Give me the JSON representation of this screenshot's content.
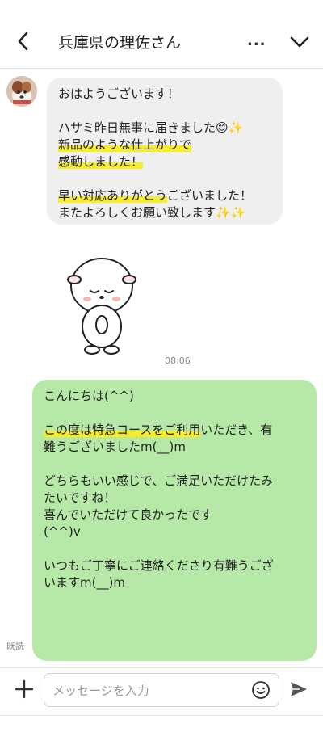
{
  "header": {
    "title": "兵庫県の理佐さん",
    "more_label": "...",
    "icons": {
      "back": "back-arrow-icon",
      "expand": "chevron-down-icon"
    }
  },
  "incoming": {
    "lines": [
      {
        "text": "おはようございます！",
        "highlight": ""
      },
      {
        "text": "",
        "highlight": ""
      },
      {
        "text": "ハサミ昨日無事に届きました😊✨",
        "highlight": ""
      },
      {
        "text": "新品のような仕上がりで",
        "highlight": "all"
      },
      {
        "text": "感動しました！",
        "highlight": "all"
      },
      {
        "text": "",
        "highlight": ""
      },
      {
        "text": "早い対応ありがとうございました！",
        "highlight": "早い対応ありがとう"
      },
      {
        "text": "またよろしくお願い致します✨✨",
        "highlight": ""
      }
    ],
    "time": "08:06"
  },
  "outgoing": {
    "lines": [
      {
        "text": "こんにちは(^^)",
        "highlight": ""
      },
      {
        "text": "",
        "highlight": ""
      },
      {
        "text": "この度は特急コースをご利用いただき、有",
        "highlight": "この度は特急コースをご利用"
      },
      {
        "text": "難うございましたm(__)m",
        "highlight": ""
      },
      {
        "text": "",
        "highlight": ""
      },
      {
        "text": "どちらもいい感じで、ご満足いただけたみ",
        "highlight": ""
      },
      {
        "text": "たいですね！",
        "highlight": ""
      },
      {
        "text": "喜んでいただけて良かったです",
        "highlight": ""
      },
      {
        "text": "(^^)v",
        "highlight": ""
      },
      {
        "text": "",
        "highlight": ""
      },
      {
        "text": "いつもご丁寧にご連絡くださり有難うござ",
        "highlight": ""
      },
      {
        "text": "いますm(__)m",
        "highlight": ""
      }
    ],
    "read_status": "既読"
  },
  "input_bar": {
    "placeholder": "メッセージを入力",
    "icons": {
      "add": "plus-icon",
      "emoji": "emoji-icon",
      "send": "send-icon"
    }
  },
  "colors": {
    "incoming_bubble": "#efefef",
    "outgoing_bubble": "#b6e8a7",
    "highlight": "#f7ee29"
  }
}
